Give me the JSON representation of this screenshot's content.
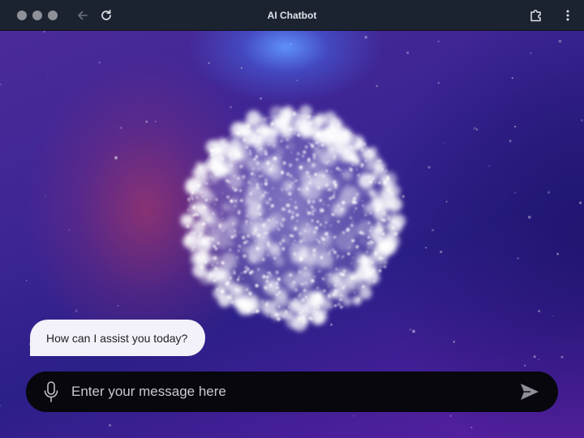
{
  "window": {
    "title": "AI Chatbot"
  },
  "toolbar": {
    "icons": [
      "back-arrow-icon",
      "reload-icon",
      "extension-puzzle-icon",
      "kebab-menu-icon"
    ]
  },
  "chat": {
    "assistant_message": "How can I assist you today?"
  },
  "composer": {
    "placeholder": "Enter your message here",
    "value": "",
    "icons": [
      "microphone-icon",
      "send-icon"
    ]
  },
  "colors": {
    "titlebar": "#1c2330",
    "title_text": "#dfe4ec",
    "bubble_bg": "#f3f1f9",
    "input_bg": "#07070d",
    "accent_glow": "#5f96ff"
  }
}
